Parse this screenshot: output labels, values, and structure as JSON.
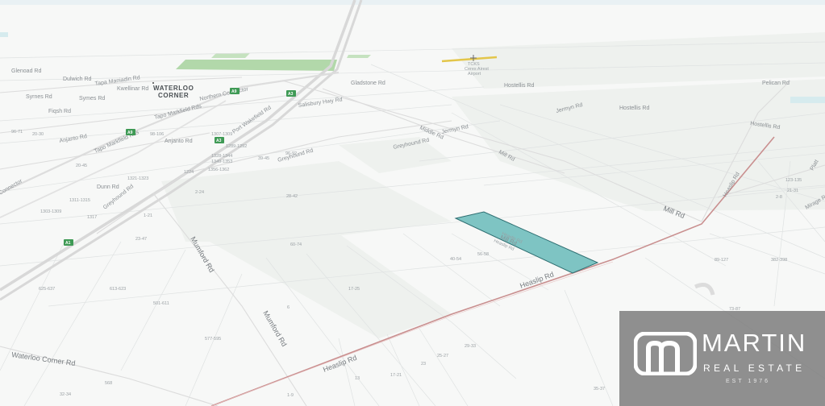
{
  "map": {
    "town": [
      "WATERLOO",
      "CORNER"
    ],
    "airport": [
      "TCKS",
      "Ceres Airest",
      "Airport"
    ],
    "roads": {
      "heaslip_1": "Heaslip Rd",
      "heaslip_2": "Heaslip Rd",
      "heaslip_3": "Heaslip Rd",
      "mill_1": "Mill Rd",
      "mill_2": "Mill Rd",
      "mumford_1": "Mumford Rd",
      "mumford_2": "Mumford Rd",
      "waterloo": "Waterloo Corner Rd",
      "greyhound_1": "Greyhound Rd",
      "greyhound_2": "Greyhound Rd",
      "greyhound_3": "Greyhound Rd",
      "dunn": "Dunn Rd",
      "anjanto": "Anjanto Rd",
      "arjanto": "Anjanto Rd",
      "port_wakefield": "Port Wakefield Rd",
      "jermyn": "Jermyn Rd",
      "jermyn2": "Jermyn Rd",
      "symes": "Symes Rd",
      "syrnes": "Syrnes Rd",
      "fiqsh": "Fiqsh Rd",
      "salisbury": "Salisbury Hwy Rd",
      "tapo": "Tapo Markfield Rds",
      "tapo2": "Tapo Markfield Rds",
      "northern": "Northern Connector",
      "connector": "Connector",
      "pelican": "Pelican Rd",
      "hostellis": "Hostellis Rd",
      "hostellis2": "Hostellis Rd",
      "hostellis3": "Hostellis Rd",
      "middle": "Middle Rd",
      "gladstone": "Gladstone Rd",
      "tapa_m": "Tapa Maniadin Rd",
      "dulwich": "Dulwich Rd",
      "glenoad": "Glenoad Rd",
      "kwellinar": "Kwellinar Rd",
      "platt": "Platt",
      "mirage": "Mirage Rd",
      "mill_lot": "Mill Rd"
    },
    "shields": {
      "a1": "A1",
      "a2": "A3",
      "a3": "A3",
      "a4": "A9",
      "a5": "A9"
    },
    "lots": {
      "l1": "625-637",
      "l2": "613-623",
      "l3": "501-611",
      "l4": "577-595",
      "l5": "6",
      "l6": "17-25",
      "l7": "60-74",
      "l8": "40-54",
      "l9": "56-58",
      "l10": "13",
      "l11": "17-21",
      "l12": "23",
      "l13": "25-27",
      "l14": "29-33",
      "l15": "1-9",
      "l16": "35-37",
      "l17": "32-34",
      "l18": "568",
      "l19": "89-127",
      "l20": "382-398",
      "l21": "73-87",
      "l22": "23-47",
      "l23": "28-42",
      "l24": "2-24",
      "l25": "1303-1309",
      "l26": "1311-1315",
      "l27": "1317",
      "l28": "1321-1323",
      "l29": "1307-1309",
      "l30": "1328-1344",
      "l31": "1349-1353",
      "l32": "1356-1362",
      "l33": "1224",
      "l34": "1289-1292",
      "l35": "20-45",
      "l36": "39-45",
      "l37": "96-92",
      "l38": "1-21",
      "l39": "123-135",
      "l40": "21-31",
      "l41": "2-8",
      "l42": "20-30",
      "l43": "96-71",
      "l44": "98-106"
    },
    "parcel_labels": [
      "Heaslip Rd",
      "Heaslip Rd"
    ]
  },
  "brand": {
    "name": "MARTIN",
    "sub": "REAL ESTATE",
    "est": "EST 1976",
    "logo": "m-monogram-icon"
  },
  "colors": {
    "parcel_fill": "#7ec4c3",
    "parcel_stroke": "#2f6f72",
    "highway": "#cfcfcf",
    "heaslip": "#c98f8f",
    "park": "#b2d8aa",
    "brand_box": "#787878"
  }
}
